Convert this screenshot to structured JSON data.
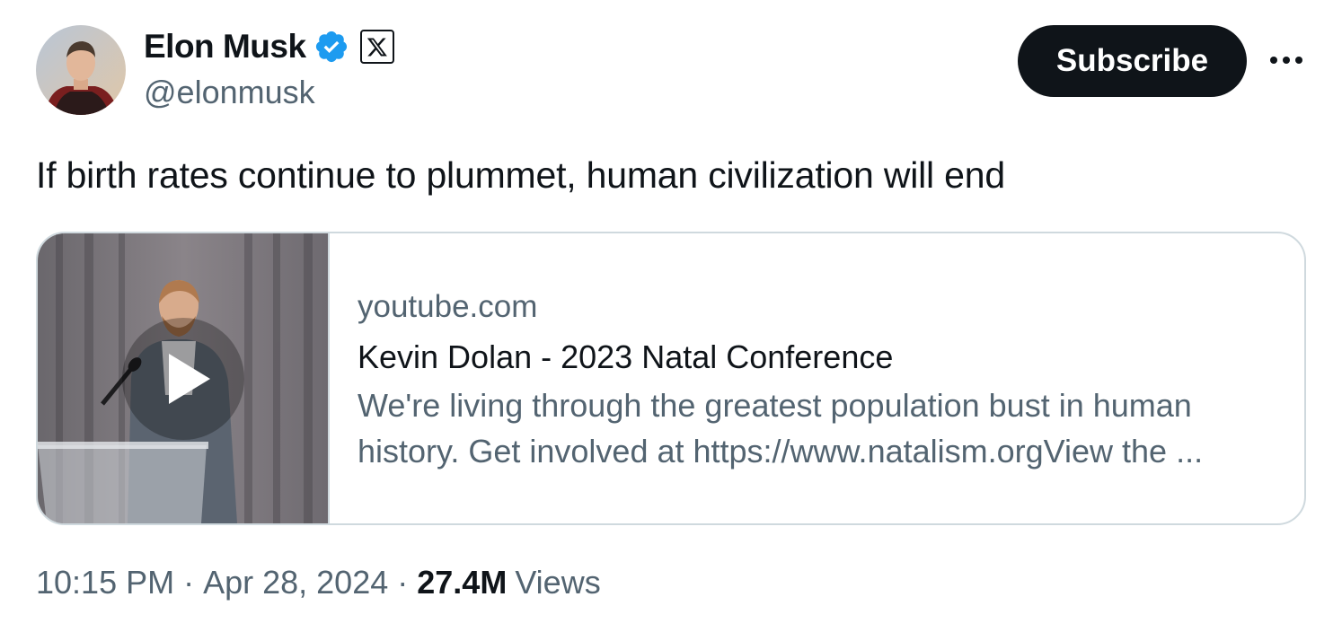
{
  "author": {
    "display_name": "Elon Musk",
    "handle": "@elonmusk",
    "verified": true,
    "affiliation_badge": "x-logo-icon"
  },
  "actions": {
    "subscribe_label": "Subscribe",
    "more_icon": "more-horizontal-icon"
  },
  "tweet": {
    "text": "If birth rates continue to plummet, human civilization will end"
  },
  "link_card": {
    "domain": "youtube.com",
    "title": "Kevin Dolan - 2023 Natal Conference",
    "description": "We're living through the greatest population bust in human history. Get involved at https://www.natalism.orgView the ...",
    "thumbnail_icon": "video-play-icon"
  },
  "meta": {
    "time": "10:15 PM",
    "separator": "·",
    "date": "Apr 28, 2024",
    "views_count": "27.4M",
    "views_label": "Views"
  },
  "colors": {
    "text_primary": "#0f1419",
    "text_secondary": "#536471",
    "verified_blue": "#1d9bf0",
    "border": "#cfd9de",
    "button_bg": "#0f1419"
  }
}
